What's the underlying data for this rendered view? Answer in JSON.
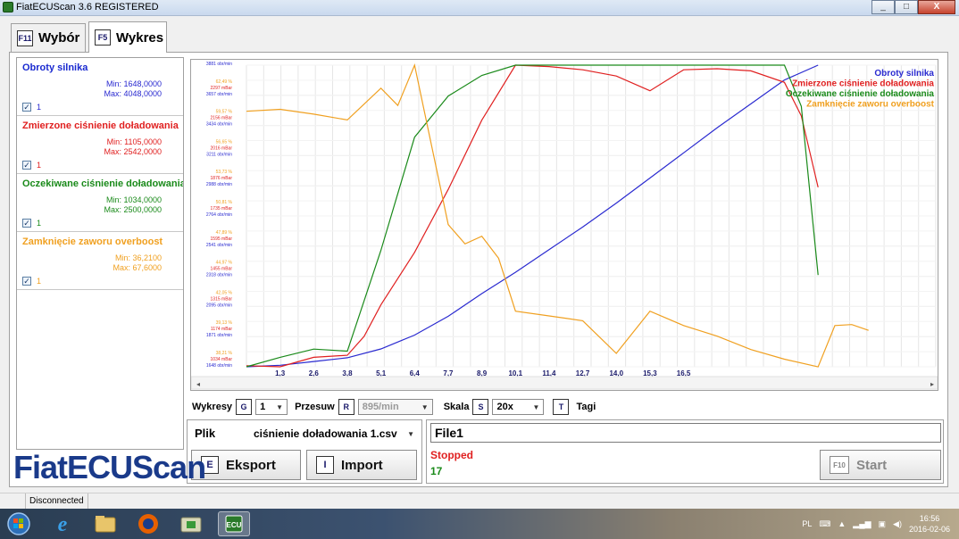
{
  "window": {
    "title": "FiatECUScan 3.6 REGISTERED",
    "controls": [
      "_",
      "□",
      "X"
    ]
  },
  "tabs": [
    {
      "key": "F11",
      "label": "Wybór",
      "active": false
    },
    {
      "key": "F5",
      "label": "Wykres",
      "active": true
    }
  ],
  "legend": [
    {
      "name": "Obroty silnika",
      "min": "Min: 1648,0000",
      "max": "Max: 4048,0000",
      "check": "✓",
      "value": "1",
      "color": "#2a2ad0"
    },
    {
      "name": "Zmierzone ciśnienie doładowania",
      "min": "Min: 1105,0000",
      "max": "Max: 2542,0000",
      "check": "✓",
      "value": "1",
      "color": "#e02020"
    },
    {
      "name": "Oczekiwane ciśnienie doładowania",
      "min": "Min: 1034,0000",
      "max": "Max: 2500,0000",
      "check": "✓",
      "value": "1",
      "color": "#1a8a1a"
    },
    {
      "name": "Zamknięcie zaworu overboost",
      "min": "Min: 36,2100",
      "max": "Max: 67,6000",
      "check": "✓",
      "value": "1",
      "color": "#f0a020"
    }
  ],
  "chart_data": {
    "type": "line",
    "title": "",
    "xlabel": "",
    "ylabel": "",
    "x_ticks": [
      "1,3",
      "2,6",
      "3,8",
      "5,1",
      "6,4",
      "7,7",
      "8,9",
      "10,1",
      "11,4",
      "12,7",
      "14,0",
      "15,3",
      "16,5"
    ],
    "xlim": [
      0,
      20.5
    ],
    "grid": true,
    "legend_position": "top-right",
    "y_axis_labels": [
      {
        "pct": "38,21 %",
        "mbar": "1034 mBar",
        "rpm": "1648 obr/min"
      },
      {
        "pct": "39,13 %",
        "mbar": "1174 mBar",
        "rpm": "1871 obr/min"
      },
      {
        "pct": "42,05 %",
        "mbar": "1315 mBar",
        "rpm": "2095 obr/min"
      },
      {
        "pct": "44,97 %",
        "mbar": "1455 mBar",
        "rpm": "2318 obr/min"
      },
      {
        "pct": "47,89 %",
        "mbar": "1595 mBar",
        "rpm": "2541 obr/min"
      },
      {
        "pct": "50,81 %",
        "mbar": "1735 mBar",
        "rpm": "2764 obr/min"
      },
      {
        "pct": "53,73 %",
        "mbar": "1876 mBar",
        "rpm": "2988 obr/min"
      },
      {
        "pct": "56,65 %",
        "mbar": "2016 mBar",
        "rpm": "3211 obr/min"
      },
      {
        "pct": "59,57 %",
        "mbar": "2156 mBar",
        "rpm": "3434 obr/min"
      },
      {
        "pct": "62,49 %",
        "mbar": "2297 mBar",
        "rpm": "3657 obr/min"
      },
      {
        "pct": "65,41 %",
        "mbar": "2437 mBar",
        "rpm": "3881 obr/min"
      }
    ],
    "series": [
      {
        "name": "Obroty silnika",
        "color": "#2a2ad0",
        "points": [
          [
            0,
            1648
          ],
          [
            1,
            1660
          ],
          [
            2,
            1690
          ],
          [
            3,
            1720
          ],
          [
            4,
            1790
          ],
          [
            5,
            1900
          ],
          [
            6,
            2050
          ],
          [
            7,
            2230
          ],
          [
            8,
            2400
          ],
          [
            9,
            2580
          ],
          [
            10,
            2760
          ],
          [
            11,
            2950
          ],
          [
            12,
            3150
          ],
          [
            13,
            3350
          ],
          [
            14,
            3550
          ],
          [
            15,
            3740
          ],
          [
            16,
            3930
          ],
          [
            17,
            4048
          ]
        ]
      },
      {
        "name": "Zmierzone ciśnienie doładowania",
        "color": "#e02020",
        "points": [
          [
            0,
            1110
          ],
          [
            1,
            1105
          ],
          [
            2,
            1150
          ],
          [
            3,
            1160
          ],
          [
            3.5,
            1250
          ],
          [
            4,
            1400
          ],
          [
            5,
            1650
          ],
          [
            6,
            1950
          ],
          [
            7,
            2280
          ],
          [
            8,
            2542
          ],
          [
            9,
            2535
          ],
          [
            10,
            2520
          ],
          [
            11,
            2490
          ],
          [
            12,
            2420
          ],
          [
            13,
            2520
          ],
          [
            14,
            2525
          ],
          [
            15,
            2515
          ],
          [
            16,
            2460
          ],
          [
            16.5,
            2300
          ],
          [
            17,
            1960
          ]
        ]
      },
      {
        "name": "Oczekiwane ciśnienie doładowania",
        "color": "#1a8a1a",
        "points": [
          [
            0,
            1034
          ],
          [
            1,
            1080
          ],
          [
            2,
            1120
          ],
          [
            3,
            1110
          ],
          [
            4,
            1600
          ],
          [
            5,
            2150
          ],
          [
            6,
            2350
          ],
          [
            7,
            2450
          ],
          [
            8,
            2500
          ],
          [
            9,
            2500
          ],
          [
            10,
            2500
          ],
          [
            11,
            2500
          ],
          [
            12,
            2500
          ],
          [
            13,
            2500
          ],
          [
            14,
            2500
          ],
          [
            15,
            2500
          ],
          [
            16,
            2500
          ],
          [
            16.5,
            2300
          ],
          [
            17,
            1480
          ]
        ]
      },
      {
        "name": "Zamknięcie zaworu overboost",
        "color": "#f0a020",
        "points": [
          [
            0,
            62.8
          ],
          [
            1,
            63.0
          ],
          [
            2,
            62.5
          ],
          [
            3,
            61.9
          ],
          [
            4,
            65.2
          ],
          [
            4.5,
            63.4
          ],
          [
            5,
            67.6
          ],
          [
            6,
            51.0
          ],
          [
            6.5,
            49.0
          ],
          [
            7,
            49.8
          ],
          [
            7.5,
            47.5
          ],
          [
            8,
            42.0
          ],
          [
            9,
            41.5
          ],
          [
            10,
            41.0
          ],
          [
            11,
            37.6
          ],
          [
            12,
            42.0
          ],
          [
            13,
            40.5
          ],
          [
            14,
            39.4
          ],
          [
            15,
            38.0
          ],
          [
            16,
            37.0
          ],
          [
            17,
            36.2
          ],
          [
            17.5,
            40.5
          ],
          [
            18,
            40.6
          ],
          [
            18.5,
            40.0
          ]
        ]
      }
    ]
  },
  "controls": {
    "wykresy_label": "Wykresy",
    "wykresy_key": "G",
    "wykresy_value": "1",
    "przesuw_label": "Przesuw",
    "przesuw_key": "R",
    "przesuw_value": "895/min",
    "skala_label": "Skala",
    "skala_key": "S",
    "skala_value": "20x",
    "tagi_key": "T",
    "tagi_label": "Tagi"
  },
  "plik": {
    "label": "Plik",
    "value": "ciśnienie doładowania 1.csv"
  },
  "buttons": {
    "eksport": {
      "key": "E",
      "label": "Eksport"
    },
    "import": {
      "key": "I",
      "label": "Import"
    },
    "start": {
      "key": "F10",
      "label": "Start"
    }
  },
  "status": {
    "file": "File1",
    "state": "Stopped",
    "count": "17",
    "state_color": "#e02020",
    "count_color": "#1a8a1a"
  },
  "logo": "FiatECUScan",
  "statusbar": {
    "connection": "Disconnected"
  },
  "taskbar": {
    "lang": "PL",
    "time": "16:56",
    "date": "2016-02-06"
  }
}
